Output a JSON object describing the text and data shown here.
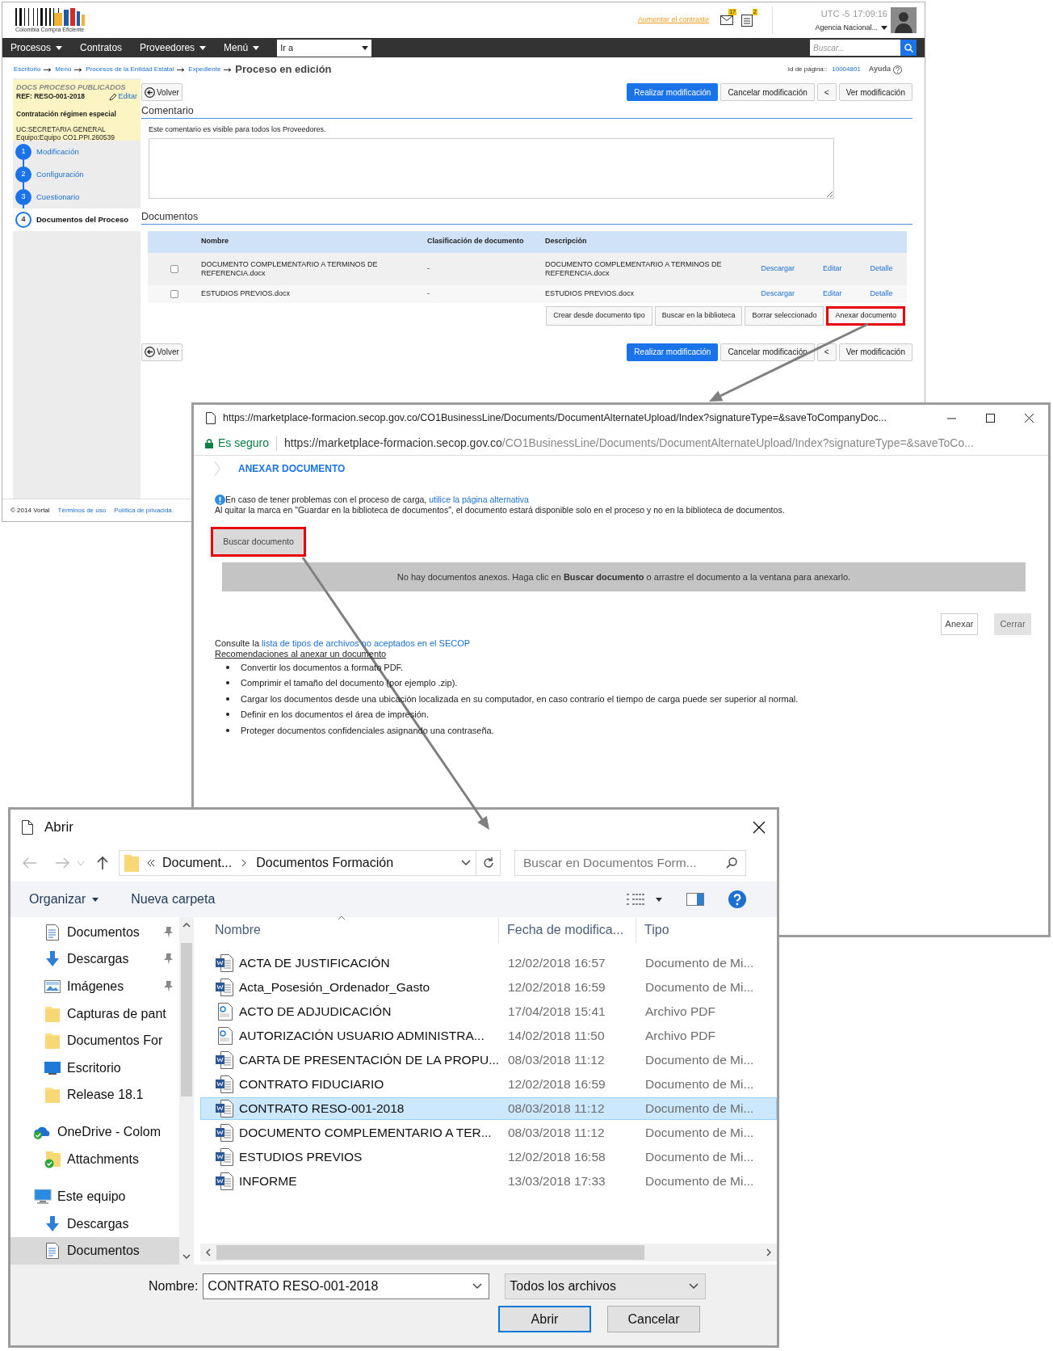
{
  "portal": {
    "logo_caption": "Colombia Compra Eficiente",
    "contrast_link": "Aumentar el contraste",
    "notifications": [
      {
        "kind": "mail",
        "count": "17"
      },
      {
        "kind": "tasks",
        "count": "2"
      }
    ],
    "timezone": "UTC -5",
    "clock": "17:09:16",
    "agency": "Agencia Nacional...",
    "menu": [
      {
        "label": "Procesos",
        "dropdown": true
      },
      {
        "label": "Contratos",
        "dropdown": false
      },
      {
        "label": "Proveedores",
        "dropdown": true
      },
      {
        "label": "Menú",
        "dropdown": true
      }
    ],
    "goto": "Ir a",
    "search_placeholder": "Buscar...",
    "breadcrumb": [
      {
        "label": "Escritorio",
        "current": false
      },
      {
        "label": "Menú",
        "current": false
      },
      {
        "label": "Procesos de la Entidad Estatal",
        "current": false
      },
      {
        "label": "Expediente",
        "current": false
      },
      {
        "label": "Proceso en edición",
        "current": true
      }
    ],
    "page_id_label": "Id de página::",
    "page_id": "10004801",
    "help": "Ayuda",
    "summary": {
      "status": "DOCS PROCESO PUBLICADOS",
      "reference": "REF: RESO-001-2018",
      "edit": "Editar",
      "regime": "Contratación régimen especial",
      "unit": "UC:SECRETARIA GENERAL",
      "team": "Equipo:Equipo CO1.PPI.260539"
    },
    "steps": [
      {
        "number": "1",
        "label": "Modificación",
        "selected": false
      },
      {
        "number": "2",
        "label": "Configuración",
        "selected": false
      },
      {
        "number": "3",
        "label": "Cuestionario",
        "selected": false
      },
      {
        "number": "4",
        "label": "Documentos del Proceso",
        "selected": true
      }
    ],
    "toolbars": [
      {
        "back": "Volver",
        "actions": [
          {
            "label": "Realizar modificación",
            "primary": true
          },
          {
            "label": "Cancelar modificación",
            "primary": false
          },
          {
            "label": "<",
            "primary": false
          },
          {
            "label": "Ver modificación",
            "primary": false
          }
        ]
      },
      {
        "back": "Volver",
        "actions": [
          {
            "label": "Realizar modificación",
            "primary": true
          },
          {
            "label": "Cancelar modificación",
            "primary": false
          },
          {
            "label": "<",
            "primary": false
          },
          {
            "label": "Ver modificación",
            "primary": false
          }
        ]
      }
    ],
    "comment": {
      "heading": "Comentario",
      "note": "Este comentario es visible para todos los Proveedores."
    },
    "documents": {
      "heading": "Documentos",
      "columns": [
        "Nombre",
        "Clasificación de documento",
        "Descripción"
      ],
      "rows": [
        {
          "checked": false,
          "name": "DOCUMENTO COMPLEMENTARIO A TERMINOS DE REFERENCIA.docx",
          "classification": "-",
          "description": "DOCUMENTO COMPLEMENTARIO A TERMINOS DE REFERENCIA.docx",
          "actions": [
            "Descargar",
            "Editar",
            "Detalle"
          ]
        },
        {
          "checked": false,
          "name": "ESTUDIOS PREVIOS.docx",
          "classification": "-",
          "description": "ESTUDIOS PREVIOS.docx",
          "actions": [
            "Descargar",
            "Editar",
            "Detalle"
          ]
        }
      ],
      "buttons": [
        {
          "label": "Crear desde documento tipo",
          "highlighted": false
        },
        {
          "label": "Buscar en la biblioteca",
          "highlighted": false
        },
        {
          "label": "Borrar seleccionado",
          "highlighted": false
        },
        {
          "label": "Anexar documento",
          "highlighted": true
        }
      ]
    },
    "footer": {
      "copyright": "© 2014 Vortal",
      "links": [
        "Términos de uso",
        "Política de privacida"
      ]
    }
  },
  "upload_window": {
    "title": "https://marketplace-formacion.secop.gov.co/CO1BusinessLine/Documents/DocumentAlternateUpload/Index?signatureType=&saveToCompanyDoc...",
    "secure_label": "Es seguro",
    "address_host": "https://marketplace-formacion.secop.gov.co",
    "address_path": "/CO1BusinessLine/Documents/DocumentAlternateUpload/Index?signatureType=&saveToCo...",
    "heading": "ANEXAR DOCUMENTO",
    "problem_text": "En caso de tener problemas con el proceso de carga, ",
    "problem_link": "utilice la página alternativa",
    "note": "Al quitar la marca en \"Guardar en la biblioteca de documentos\", el documento estará disponible solo en el proceso y no en la biblioteca de documentos.",
    "browse_button": {
      "label": "Buscar documento",
      "highlighted": true
    },
    "empty_message": "No hay documentos anexos. Haga clic en **Buscar documento** o arrastre el documento a la ventana para anexarlo.",
    "buttons": [
      {
        "label": "Anexar",
        "kind": "outline"
      },
      {
        "label": "Cerrar",
        "kind": "solid"
      }
    ],
    "consult_text": "Consulte la ",
    "consult_link": "lista de tipos de archivos no aceptados en el SECOP",
    "recommendations_title": "Recomendaciones al anexar un documento",
    "recommendations": [
      "Convertir los documentos a formato PDF.",
      "Comprimir el tamaño del documento (por ejemplo .zip).",
      "Cargar los documentos desde una ubicación localizada en su computador, en caso contrario el tiempo de carga puede ser superior al normal.",
      "Definir en los documentos el área de impresión.",
      "Proteger documentos confidenciales asignando una contraseña."
    ]
  },
  "open_dialog": {
    "title": "Abrir",
    "path": [
      "Document...",
      "Documentos Formación"
    ],
    "search_placeholder": "Buscar en Documentos Form...",
    "commands": [
      {
        "label": "Organizar",
        "dropdown": true
      },
      {
        "label": "Nueva carpeta",
        "dropdown": false
      }
    ],
    "quick_access": [
      {
        "label": "Documentos",
        "kind": "documents",
        "pinned": true,
        "selected": false
      },
      {
        "label": "Descargas",
        "kind": "downloads",
        "pinned": true,
        "selected": false
      },
      {
        "label": "Imágenes",
        "kind": "pictures",
        "pinned": true,
        "selected": false
      },
      {
        "label": "Capturas de pant",
        "kind": "folder",
        "pinned": false,
        "selected": false
      },
      {
        "label": "Documentos For",
        "kind": "folder",
        "pinned": false,
        "selected": false
      },
      {
        "label": "Escritorio",
        "kind": "desktop",
        "pinned": false,
        "selected": false
      },
      {
        "label": "Release 18.1",
        "kind": "folder",
        "pinned": false,
        "selected": false
      }
    ],
    "locations": [
      {
        "label": "OneDrive - Colom",
        "kind": "cloud",
        "selected": false,
        "children": [
          {
            "label": "Attachments",
            "kind": "synced",
            "selected": false
          }
        ]
      },
      {
        "label": "Este equipo",
        "kind": "computer",
        "selected": false,
        "children": [
          {
            "label": "Descargas",
            "kind": "downloads",
            "selected": false
          },
          {
            "label": "Documentos",
            "kind": "documents",
            "selected": true
          }
        ]
      }
    ],
    "columns": [
      "Nombre",
      "Fecha de modifica...",
      "Tipo"
    ],
    "files": [
      {
        "name": "ACTA DE JUSTIFICACIÓN",
        "date": "12/02/2018 16:57",
        "type": "Documento de Mi...",
        "kind": "word",
        "selected": false
      },
      {
        "name": "Acta_Posesión_Ordenador_Gasto",
        "date": "12/02/2018 16:59",
        "type": "Documento de Mi...",
        "kind": "word",
        "selected": false
      },
      {
        "name": "ACTO DE ADJUDICACIÓN",
        "date": "17/04/2018 15:41",
        "type": "Archivo PDF",
        "kind": "pdf",
        "selected": false
      },
      {
        "name": "AUTORIZACIÓN USUARIO ADMINISTRA...",
        "date": "14/02/2018 11:50",
        "type": "Archivo PDF",
        "kind": "pdf",
        "selected": false
      },
      {
        "name": "CARTA DE PRESENTACIÓN DE LA PROPU...",
        "date": "08/03/2018 11:12",
        "type": "Documento de Mi...",
        "kind": "word",
        "selected": false
      },
      {
        "name": "CONTRATO FIDUCIARIO",
        "date": "12/02/2018 16:59",
        "type": "Documento de Mi...",
        "kind": "word",
        "selected": false
      },
      {
        "name": "CONTRATO RESO-001-2018",
        "date": "08/03/2018 11:12",
        "type": "Documento de Mi...",
        "kind": "word",
        "selected": true
      },
      {
        "name": "DOCUMENTO COMPLEMENTARIO A TER...",
        "date": "08/03/2018 11:12",
        "type": "Documento de Mi...",
        "kind": "word",
        "selected": false
      },
      {
        "name": "ESTUDIOS PREVIOS",
        "date": "12/02/2018 16:58",
        "type": "Documento de Mi...",
        "kind": "word",
        "selected": false
      },
      {
        "name": "INFORME",
        "date": "13/03/2018 17:33",
        "type": "Documento de Mi...",
        "kind": "word",
        "selected": false
      }
    ],
    "filename_label": "Nombre:",
    "filename": "CONTRATO RESO-001-2018",
    "filter": "Todos los archivos",
    "buttons": [
      {
        "label": "Abrir",
        "default": true
      },
      {
        "label": "Cancelar",
        "default": false
      }
    ]
  }
}
